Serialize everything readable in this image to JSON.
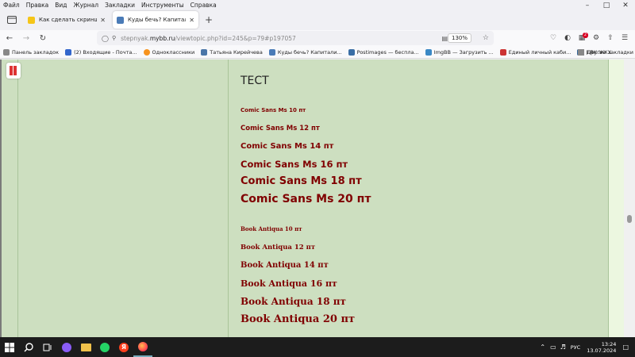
{
  "menubar": {
    "items": [
      "Файл",
      "Правка",
      "Вид",
      "Журнал",
      "Закладки",
      "Инструменты",
      "Справка"
    ]
  },
  "tabs": [
    {
      "title": "Как сделать скриншот экрана",
      "favicon_color": "#f5c518",
      "active": false
    },
    {
      "title": "Куды бечь? Капитализм vs со",
      "favicon_color": "#4a7bb7",
      "active": true
    }
  ],
  "navbar": {
    "url_prefix": "stepnyak.",
    "url_host": "mybb.ru",
    "url_path": "/viewtopic.php?id=245&p=79#p197057",
    "zoom": "130%",
    "extension_badge": "2"
  },
  "bookmarks": {
    "items": [
      {
        "label": "Панель закладок",
        "color": "#888888"
      },
      {
        "label": "(2) Входящие - Почта...",
        "color": "#3366cc"
      },
      {
        "label": "Одноклассники",
        "color": "#f7931e"
      },
      {
        "label": "Татьяна Кирейчева",
        "color": "#4a76a8"
      },
      {
        "label": "Куды бечь? Капитали...",
        "color": "#4a7bb7"
      },
      {
        "label": "Postimages — беспла...",
        "color": "#3a6ea5"
      },
      {
        "label": "ImgBB — Загрузить ...",
        "color": "#3a88c5"
      },
      {
        "label": "Единый личный каби...",
        "color": "#cc3333"
      },
      {
        "label": "ЕЛК ЖКХ",
        "color": "#336699"
      }
    ],
    "other": "Другие закладки"
  },
  "post": {
    "heading": "ТЕСТ",
    "comic_lines": [
      {
        "text": "Comic Sans Ms 10 пт",
        "size": 10
      },
      {
        "text": "Comic Sans Ms 12 пт",
        "size": 12
      },
      {
        "text": "Comic Sans Ms 14 пт",
        "size": 14
      },
      {
        "text": "Comic Sans Ms 16 пт",
        "size": 16
      },
      {
        "text": "Comic Sans Ms 18 пт",
        "size": 18
      },
      {
        "text": "Comic Sans Ms 20 пт",
        "size": 20
      }
    ],
    "antiqua_lines": [
      {
        "text": "Book Antiqua 10 пт",
        "size": 10
      },
      {
        "text": "Book Antiqua 12 пт",
        "size": 12
      },
      {
        "text": "Book Antiqua 14 пт",
        "size": 14
      },
      {
        "text": "Book Antiqua 16 пт",
        "size": 16
      },
      {
        "text": "Book Antiqua 18 пт",
        "size": 18
      },
      {
        "text": "Book Antiqua 20 пт",
        "size": 20
      }
    ],
    "text_color": "#800000"
  },
  "taskbar": {
    "language": "РУС",
    "time": "13:24",
    "date": "13.07.2024"
  }
}
